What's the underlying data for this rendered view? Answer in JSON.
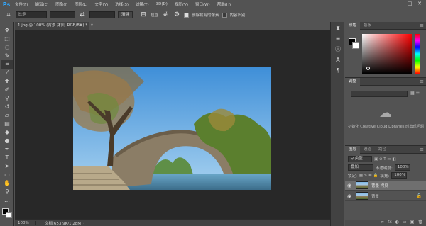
{
  "menubar": {
    "logo": "Ps",
    "items": [
      "文件(F)",
      "编辑(E)",
      "图像(I)",
      "图层(L)",
      "文字(Y)",
      "选择(S)",
      "滤镜(T)",
      "3D(D)",
      "视图(V)",
      "窗口(W)",
      "帮助(H)"
    ],
    "minimize": "—",
    "maximize": "□",
    "close": "✕"
  },
  "options": {
    "ratio": "比例",
    "swap": "⇄",
    "clear": "清除",
    "straighten": "拉直",
    "delete_cropped": "删除裁剪的像素",
    "content_aware": "内容识别",
    "delete_cropped_checked": true,
    "content_aware_checked": false
  },
  "document": {
    "tab_title": "1.jpg @ 100% (背景 拷贝, RGB/8#) *",
    "close": "×"
  },
  "status": {
    "zoom": "100%",
    "doc_size": "文档:653.9K/1.28M",
    "arrow": "›"
  },
  "color_panel": {
    "tabs": [
      "颜色",
      "色板"
    ],
    "colors": {
      "foreground": "#000000",
      "background": "#ffffff"
    }
  },
  "adjust_panel": {
    "tabs": [
      "调整"
    ],
    "cloud_message": "初始化 Creative Cloud Libraries 时出现问题"
  },
  "layers_panel": {
    "tabs": [
      "图层",
      "通道",
      "路径"
    ],
    "filter_kind": "类型",
    "blend_mode": "叠加",
    "opacity_label": "不透明度:",
    "opacity": "100%",
    "lock_label": "锁定:",
    "fill_label": "填充:",
    "fill": "100%",
    "layers": [
      {
        "name": "背景 拷贝",
        "selected": true
      },
      {
        "name": "背景",
        "selected": false
      }
    ],
    "footer_icons": [
      "∞",
      "fx",
      "◐",
      "▭",
      "▣",
      "🗑"
    ]
  },
  "tools": [
    "move-tool",
    "marquee-tool",
    "lasso-tool",
    "quick-select-tool",
    "crop-tool",
    "eyedropper-tool",
    "healing-tool",
    "brush-tool",
    "stamp-tool",
    "history-brush-tool",
    "eraser-tool",
    "gradient-tool",
    "blur-tool",
    "dodge-tool",
    "pen-tool",
    "type-tool",
    "path-select-tool",
    "shape-tool",
    "hand-tool",
    "zoom-tool"
  ]
}
